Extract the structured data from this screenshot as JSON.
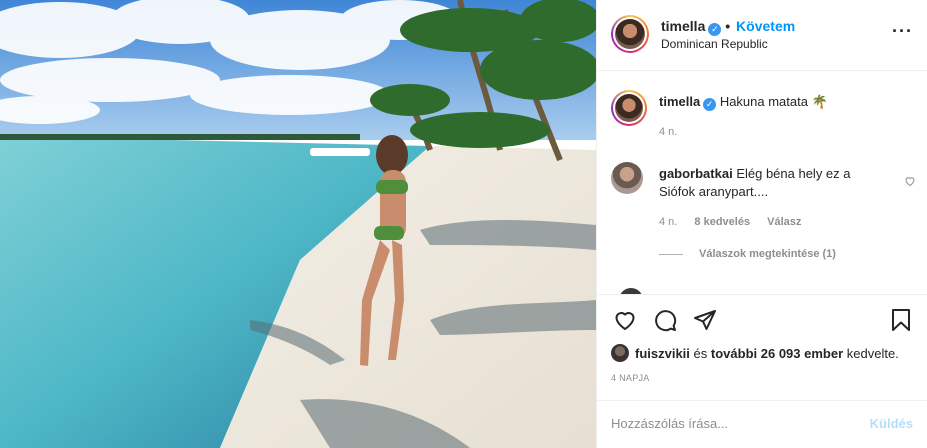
{
  "header": {
    "username": "timella",
    "separator": "•",
    "follow_label": "Követem",
    "location": "Dominican Republic",
    "more_icon": "more-options-icon"
  },
  "caption": {
    "username": "timella",
    "text": "Hakuna matata",
    "emoji": "🌴",
    "age": "4 n."
  },
  "comments": [
    {
      "username": "gaborbatkai",
      "text": "Elég béna hely ez a Siófok aranypart....",
      "age": "4 n.",
      "likes": "8 kedvelés",
      "reply_label": "Válasz",
      "view_replies": "Válaszok megtekintése (1)"
    }
  ],
  "likes": {
    "first_user": "fuiszvikii",
    "connector": "és",
    "others": "további 26 093 ember",
    "suffix": "kedvelte."
  },
  "date": "4 NAPJA",
  "comment_box": {
    "placeholder": "Hozzászólás írása...",
    "send_label": "Küldés"
  },
  "colors": {
    "accent": "#0095f6",
    "verified": "#3897f0",
    "muted": "#8e8e8e",
    "send_disabled": "#b2dffc"
  }
}
